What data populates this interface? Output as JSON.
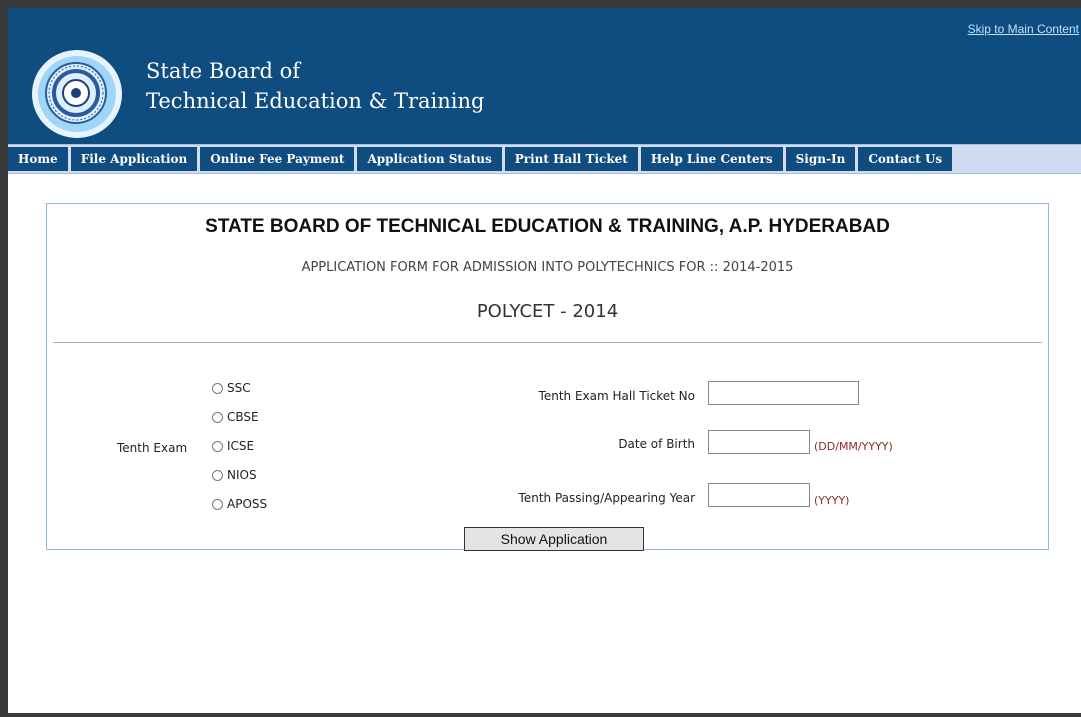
{
  "header": {
    "skip_link": "Skip to Main Content",
    "brand_line1": "State Board of",
    "brand_line2": "Technical Education & Training"
  },
  "nav": {
    "items": [
      {
        "label": "Home",
        "name": "nav-home"
      },
      {
        "label": "File Application",
        "name": "nav-file-application"
      },
      {
        "label": "Online Fee Payment",
        "name": "nav-online-fee-payment"
      },
      {
        "label": "Application Status",
        "name": "nav-application-status"
      },
      {
        "label": "Print Hall Ticket",
        "name": "nav-print-hall-ticket"
      },
      {
        "label": "Help Line Centers",
        "name": "nav-help-line-centers"
      },
      {
        "label": "Sign-In",
        "name": "nav-sign-in"
      },
      {
        "label": "Contact Us",
        "name": "nav-contact-us"
      }
    ]
  },
  "form": {
    "title": "STATE BOARD OF TECHNICAL EDUCATION & TRAINING, A.P. HYDERABAD",
    "subtitle": "APPLICATION FORM FOR ADMISSION INTO POLYTECHNICS FOR :: 2014-2015",
    "exam_name": "POLYCET - 2014",
    "tenth_exam_label": "Tenth Exam",
    "tenth_exam_options": [
      "SSC",
      "CBSE",
      "ICSE",
      "NIOS",
      "APOSS"
    ],
    "hall_ticket_label": "Tenth Exam Hall Ticket No",
    "hall_ticket_value": "",
    "dob_label": "Date of Birth",
    "dob_value": "",
    "dob_hint": "(DD/MM/YYYY)",
    "year_label": "Tenth Passing/Appearing Year",
    "year_value": "",
    "year_hint": "(YYYY)",
    "submit_label": "Show Application"
  },
  "colors": {
    "header_bg": "#0f4c80",
    "nav_strip": "#cfdcf2",
    "hint_red": "#8b2a2a",
    "panel_border": "#8fb8e0"
  }
}
